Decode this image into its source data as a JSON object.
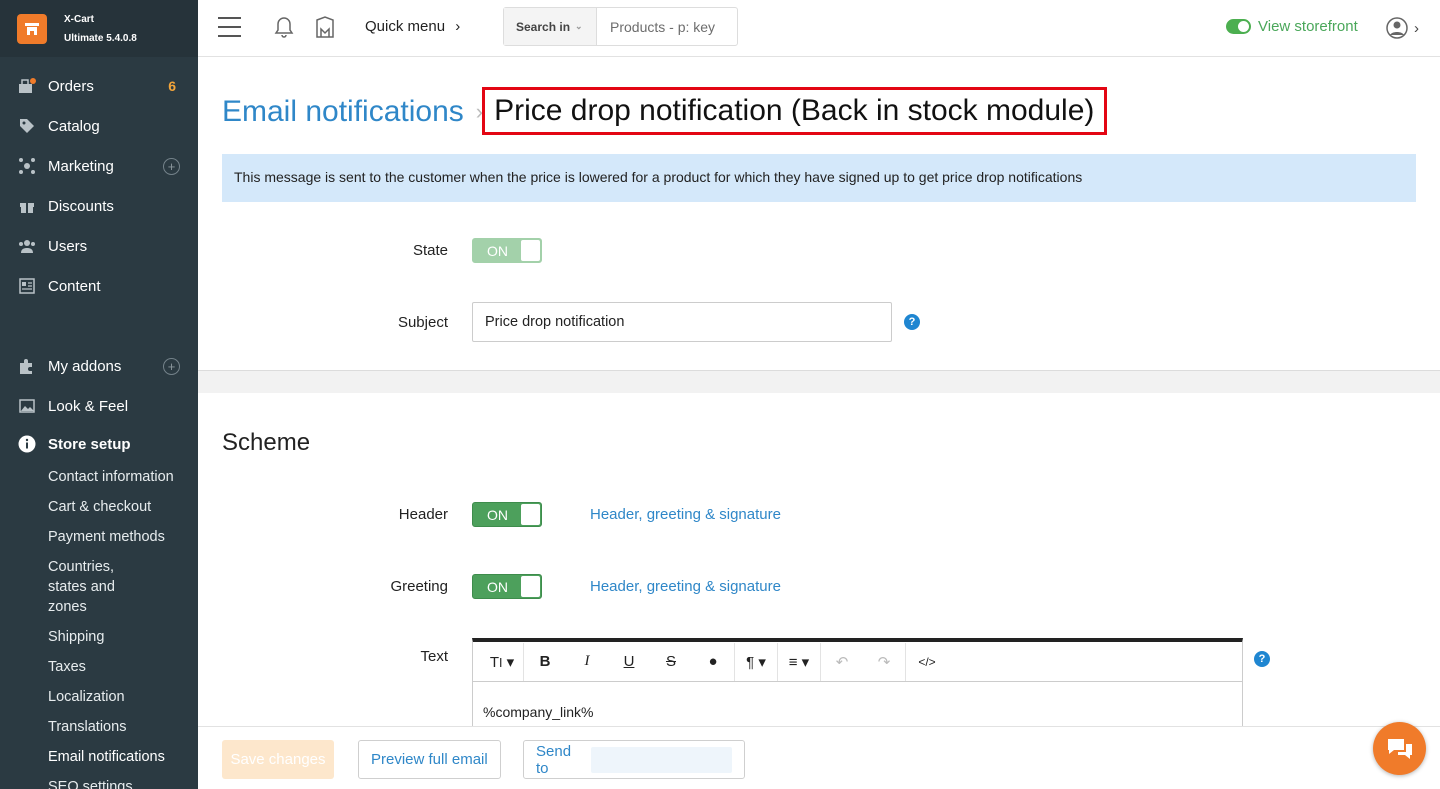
{
  "brand": {
    "name": "X-Cart",
    "edition": "Ultimate 5.4.0.8"
  },
  "sidebar": {
    "items": [
      {
        "label": "Orders",
        "icon": "orders-icon",
        "badge": "6"
      },
      {
        "label": "Catalog",
        "icon": "tag-icon"
      },
      {
        "label": "Marketing",
        "icon": "marketing-icon"
      },
      {
        "label": "Discounts",
        "icon": "gift-icon"
      },
      {
        "label": "Users",
        "icon": "users-icon"
      },
      {
        "label": "Content",
        "icon": "content-icon"
      },
      {
        "label": "My addons",
        "icon": "puzzle-icon"
      },
      {
        "label": "Look & Feel",
        "icon": "image-icon"
      },
      {
        "label": "Store setup",
        "icon": "info-icon"
      }
    ],
    "store_setup_items": [
      "Contact information",
      "Cart & checkout",
      "Payment methods",
      "Countries, states and zones",
      "Shipping",
      "Taxes",
      "Localization",
      "Translations",
      "Email notifications",
      "SEO settings"
    ]
  },
  "topbar": {
    "quick_menu": "Quick menu",
    "search_in": "Search in",
    "search_placeholder": "Products - p: key",
    "view_storefront": "View storefront"
  },
  "page": {
    "breadcrumb_parent": "Email notifications",
    "title": "Price drop notification (Back in stock module)",
    "info": "This message is sent to the customer when the price is lowered for a product for which they have signed up to get price drop notifications",
    "state_label": "State",
    "state_value": "ON",
    "subject_label": "Subject",
    "subject_value": "Price drop notification",
    "scheme_title": "Scheme",
    "header_label": "Header",
    "header_value": "ON",
    "header_link": "Header, greeting & signature",
    "greeting_label": "Greeting",
    "greeting_value": "ON",
    "greeting_link": "Header, greeting & signature",
    "text_label": "Text",
    "editor_text": "%company_link%"
  },
  "footer": {
    "save": "Save changes",
    "preview": "Preview full email",
    "send_to": "Send to"
  },
  "colors": {
    "accent": "#2f87c8",
    "toggle_on": "#4da05c",
    "sidebar": "#2b3a42",
    "brand": "#f07b2a",
    "highlight_box": "#e30613"
  }
}
